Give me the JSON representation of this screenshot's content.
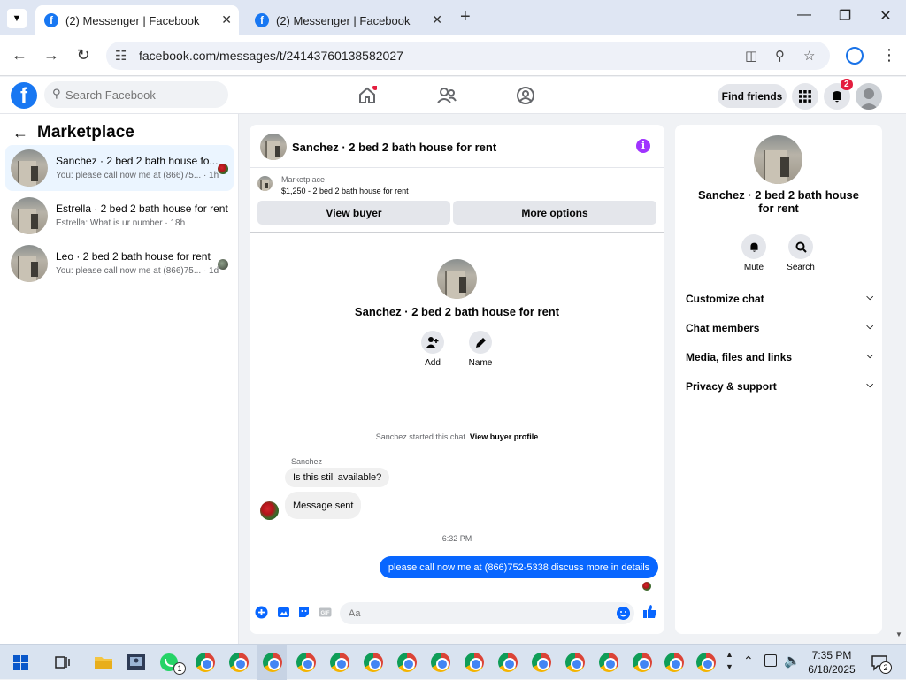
{
  "browser": {
    "tabs": [
      {
        "title": "(2) Messenger | Facebook",
        "active": true
      },
      {
        "title": "(2) Messenger | Facebook",
        "active": false
      }
    ],
    "url": "facebook.com/messages/t/24143760138582027"
  },
  "fb_header": {
    "search_placeholder": "Search Facebook",
    "find_friends_label": "Find friends",
    "notification_count": "2"
  },
  "sidebar": {
    "title": "Marketplace",
    "conversations": [
      {
        "name": "Sanchez · 2 bed 2 bath house fo...",
        "snippet": "You: please call now me at (866)75... · 1h",
        "selected": true
      },
      {
        "name": "Estrella · 2 bed 2 bath house for rent",
        "snippet": "Estrella: What is ur number · 18h",
        "selected": false
      },
      {
        "name": "Leo · 2 bed 2 bath house for rent",
        "snippet": "You: please call now me at (866)75... · 1d",
        "selected": false
      }
    ]
  },
  "chat": {
    "title": "Sanchez · 2 bed 2 bath house for rent",
    "marketplace_label": "Marketplace",
    "listing": "$1,250 - 2 bed 2 bath house for rent",
    "view_buyer_label": "View buyer",
    "more_options_label": "More options",
    "profile_name": "Sanchez · 2 bed 2 bath house for rent",
    "add_label": "Add",
    "name_label": "Name",
    "started_text": "Sanchez started this chat.",
    "view_buyer_profile_label": "View buyer profile",
    "sender_name": "Sanchez",
    "incoming_messages": [
      "Is this still available?",
      "Message sent"
    ],
    "timestamp": "6:32 PM",
    "outgoing_message": "please call now me at (866)752-5338 discuss more in details",
    "input_placeholder": "Aa"
  },
  "details": {
    "name": "Sanchez · 2 bed 2 bath house for rent",
    "mute_label": "Mute",
    "search_label": "Search",
    "sections": [
      "Customize chat",
      "Chat members",
      "Media, files and links",
      "Privacy & support"
    ]
  },
  "taskbar": {
    "whatsapp_badge": "1",
    "time": "7:35 PM",
    "date": "6/18/2025",
    "notification_count": "2"
  },
  "colors": {
    "facebook_blue": "#1877f2",
    "messenger_bubble": "#0866ff",
    "badge_red": "#e41e3f",
    "info_purple": "#a033ff"
  }
}
